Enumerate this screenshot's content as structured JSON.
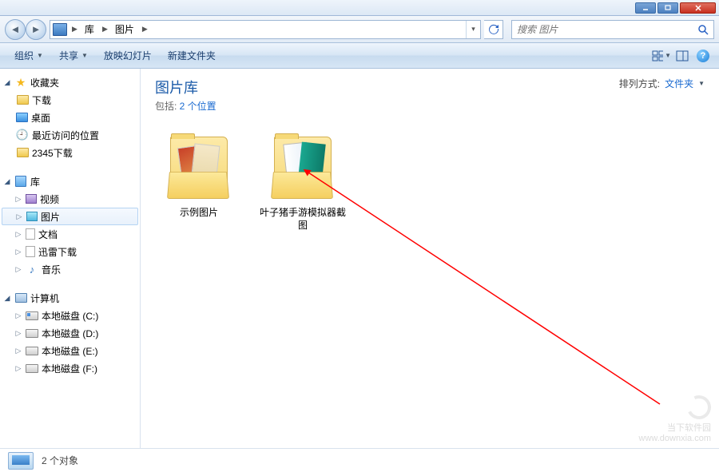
{
  "breadcrumb": {
    "seg1": "库",
    "seg2": "图片"
  },
  "search": {
    "placeholder": "搜索 图片"
  },
  "toolbar": {
    "organize": "组织",
    "share": "共享",
    "slideshow": "放映幻灯片",
    "newfolder": "新建文件夹"
  },
  "sidebar": {
    "favorites": {
      "label": "收藏夹",
      "items": [
        "下载",
        "桌面",
        "最近访问的位置",
        "2345下载"
      ]
    },
    "libraries": {
      "label": "库",
      "items": [
        "视频",
        "图片",
        "文档",
        "迅雷下载",
        "音乐"
      ]
    },
    "computer": {
      "label": "计算机",
      "items": [
        "本地磁盘 (C:)",
        "本地磁盘 (D:)",
        "本地磁盘 (E:)",
        "本地磁盘 (F:)"
      ]
    }
  },
  "library": {
    "title": "图片库",
    "includes_label": "包括: ",
    "includes_link": "2 个位置",
    "sort_label": "排列方式:",
    "sort_value": "文件夹"
  },
  "items": [
    {
      "name": "示例图片"
    },
    {
      "name": "叶子猪手游模拟器截图"
    }
  ],
  "status": {
    "count": "2 个对象"
  },
  "watermark": {
    "text1": "当下软件园",
    "text2": "www.downxia.com"
  }
}
